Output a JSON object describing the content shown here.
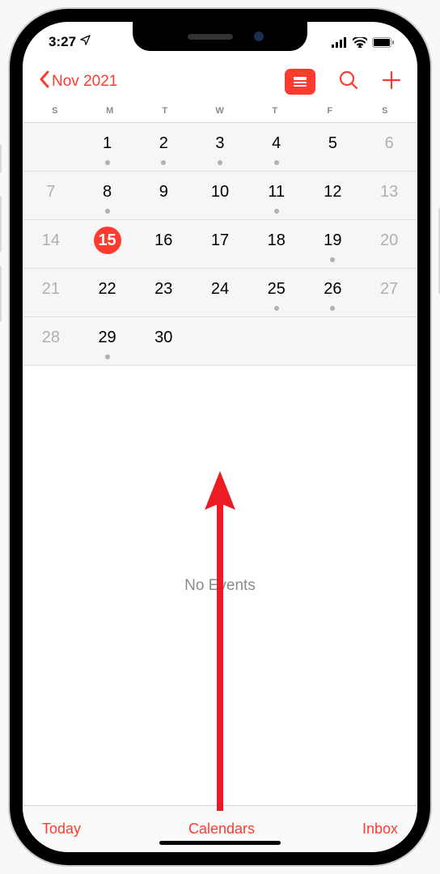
{
  "status_bar": {
    "time": "3:27"
  },
  "header": {
    "month_label": "Nov 2021"
  },
  "weekdays": [
    "S",
    "M",
    "T",
    "W",
    "T",
    "F",
    "S"
  ],
  "selected_day": 15,
  "weeks": [
    [
      {
        "n": "",
        "outside": false,
        "dot": false
      },
      {
        "n": "1",
        "outside": false,
        "dot": true
      },
      {
        "n": "2",
        "outside": false,
        "dot": true
      },
      {
        "n": "3",
        "outside": false,
        "dot": true
      },
      {
        "n": "4",
        "outside": false,
        "dot": true
      },
      {
        "n": "5",
        "outside": false,
        "dot": false
      },
      {
        "n": "6",
        "outside": true,
        "dot": false
      }
    ],
    [
      {
        "n": "7",
        "outside": true,
        "dot": false
      },
      {
        "n": "8",
        "outside": false,
        "dot": true
      },
      {
        "n": "9",
        "outside": false,
        "dot": false
      },
      {
        "n": "10",
        "outside": false,
        "dot": false
      },
      {
        "n": "11",
        "outside": false,
        "dot": true
      },
      {
        "n": "12",
        "outside": false,
        "dot": false
      },
      {
        "n": "13",
        "outside": true,
        "dot": false
      }
    ],
    [
      {
        "n": "14",
        "outside": true,
        "dot": false
      },
      {
        "n": "15",
        "outside": false,
        "dot": false,
        "selected": true
      },
      {
        "n": "16",
        "outside": false,
        "dot": false
      },
      {
        "n": "17",
        "outside": false,
        "dot": false
      },
      {
        "n": "18",
        "outside": false,
        "dot": false
      },
      {
        "n": "19",
        "outside": false,
        "dot": true
      },
      {
        "n": "20",
        "outside": true,
        "dot": false
      }
    ],
    [
      {
        "n": "21",
        "outside": true,
        "dot": false
      },
      {
        "n": "22",
        "outside": false,
        "dot": false
      },
      {
        "n": "23",
        "outside": false,
        "dot": false
      },
      {
        "n": "24",
        "outside": false,
        "dot": false
      },
      {
        "n": "25",
        "outside": false,
        "dot": true
      },
      {
        "n": "26",
        "outside": false,
        "dot": true
      },
      {
        "n": "27",
        "outside": true,
        "dot": false
      }
    ],
    [
      {
        "n": "28",
        "outside": true,
        "dot": false
      },
      {
        "n": "29",
        "outside": false,
        "dot": true
      },
      {
        "n": "30",
        "outside": false,
        "dot": false
      },
      {
        "n": "",
        "outside": false,
        "dot": false
      },
      {
        "n": "",
        "outside": false,
        "dot": false
      },
      {
        "n": "",
        "outside": false,
        "dot": false
      },
      {
        "n": "",
        "outside": false,
        "dot": false
      }
    ]
  ],
  "events_area": {
    "empty_text": "No Events"
  },
  "bottom": {
    "today": "Today",
    "calendars": "Calendars",
    "inbox": "Inbox"
  },
  "colors": {
    "accent": "#ff3b30"
  }
}
